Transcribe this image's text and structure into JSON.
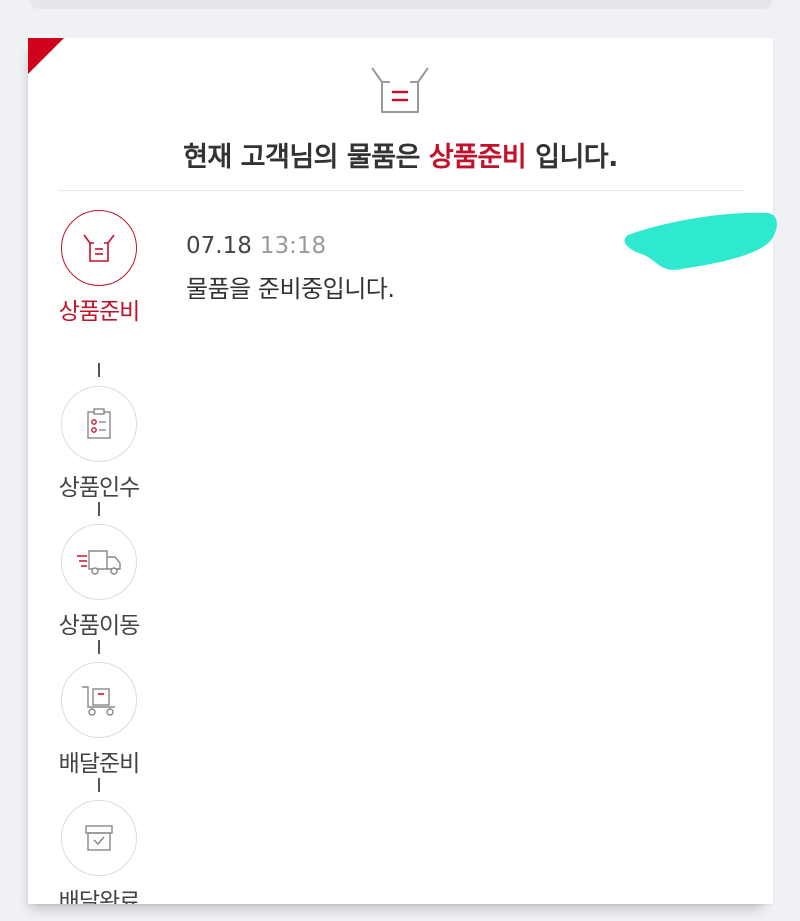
{
  "headline": {
    "prefix": "현재 고객님의 물품은 ",
    "status": "상품준비",
    "suffix": " 입니다."
  },
  "steps": [
    {
      "label": "상품준비",
      "icon": "box-icon",
      "active": true
    },
    {
      "label": "상품인수",
      "icon": "clipboard-icon",
      "active": false
    },
    {
      "label": "상품이동",
      "icon": "truck-icon",
      "active": false
    },
    {
      "label": "배달준비",
      "icon": "cart-icon",
      "active": false
    },
    {
      "label": "배달완료",
      "icon": "archive-box-icon",
      "active": false
    }
  ],
  "entry": {
    "date": "07.18",
    "time": "13:18",
    "message": "물품을 준비중입니다."
  },
  "colors": {
    "accent": "#c2122a",
    "redaction": "#2ee8cf"
  }
}
